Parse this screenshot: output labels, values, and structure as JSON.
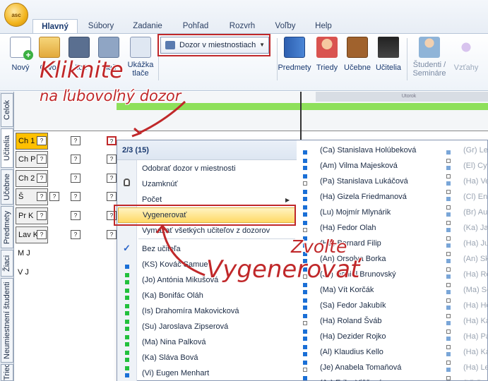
{
  "app": {
    "logo_text": "asc"
  },
  "tabs": [
    {
      "label": "Hlavný",
      "active": true
    },
    {
      "label": "Súbory"
    },
    {
      "label": "Zadanie"
    },
    {
      "label": "Pohľad"
    },
    {
      "label": "Rozvrh"
    },
    {
      "label": "Voľby"
    },
    {
      "label": "Help"
    }
  ],
  "ribbon": {
    "new": "Nový",
    "open": "Otvor",
    "save": "Ulož",
    "print": "Tlač",
    "preview_line1": "Ukážka",
    "preview_line2": "tlače",
    "dropdown": "Dozor v miestnostiach",
    "teachers_classes": "Predmety",
    "classes": "Triedy",
    "rooms": "Učebne",
    "teachers": "Učitelia",
    "students": "Študenti /",
    "seminars": "Semináre",
    "links": "Vzťahy"
  },
  "sidebar_tabs": [
    "Celok",
    "Učitelia",
    "Učebne",
    "Predmety",
    "Žiaci",
    "Neumiestnení študenti",
    "Triedy"
  ],
  "grid": {
    "day_label": "Utorok",
    "rows": [
      {
        "label": "Ch 1",
        "selected": true
      },
      {
        "label": "Ch P"
      },
      {
        "label": "Ch 2"
      },
      {
        "label": "Š"
      },
      {
        "label": "Pr K"
      },
      {
        "label": "Lav K"
      },
      {
        "label": "M J"
      },
      {
        "label": "V J"
      }
    ],
    "cell_mark": "?"
  },
  "context_menu": {
    "header": "2/3 (15)",
    "remove": "Odobrať dozor v miestnosti",
    "lock": "Uzamknúť",
    "count": "Počet",
    "generate": "Vygenerovať",
    "remove_all": "Vymazať všetkých učiteľov z dozorov",
    "no_teacher": "Bez učiteľa",
    "col1": [
      "(KS) Kováč Samuel",
      "(Jo) Antónia Mikušová",
      "(Ka) Bonifác Oláh",
      "(Is) Drahomíra Makovicková",
      "(Su) Jaroslava Zipserová",
      "(Ma) Nina Palková",
      "(Ka) Sláva Bová",
      "(Vi) Eugen Menhart"
    ],
    "col2": [
      "(Ca) Stanislava Holúbeková",
      "(Am) Vilma Majesková",
      "(Pa) Stanislava Lukáčová",
      "(Ha) Gizela Friedmanová",
      "(Lu) Mojmír Mlynárik",
      "(Ha) Fedor Olah",
      "(Ha) Bernard Filip",
      "(An) Orsolya Borka",
      "(Jo) Daniel Brunovský",
      "(Ma) Vít Korčák",
      "(Sa) Fedor Jakubík",
      "(Ha) Roland Šváb",
      "(Ha) Dezider Rojko",
      "(Al) Klaudius Kello",
      "(Je) Anabela Tomaňová",
      "(Je) Erika Viščová"
    ],
    "col3": [
      "(Gr) Le",
      "(El) Cy",
      "(Ha) Ve",
      "(Cl) En",
      "(Br) Au",
      "(Ka) Ja",
      "(Ha) Ju",
      "(An) Sk",
      "(Ha) Ro",
      "(Ma) Se",
      "(Ha) Ho",
      "(Ha) Ka",
      "(Ha) Pa",
      "(Ha) Ka",
      "(Ha) Le",
      "(Li) Ba"
    ]
  },
  "annotations": {
    "click_line1": "Kliknite",
    "click_line2": "na ľubovoľný dozor",
    "choose": "Zvoľte",
    "generate": "Vygenerovať"
  },
  "colors": {
    "annotation": "#c0282a",
    "highlight": "#ffd966",
    "selected_row": "#ffc000",
    "green_bar": "#8ee05a"
  }
}
